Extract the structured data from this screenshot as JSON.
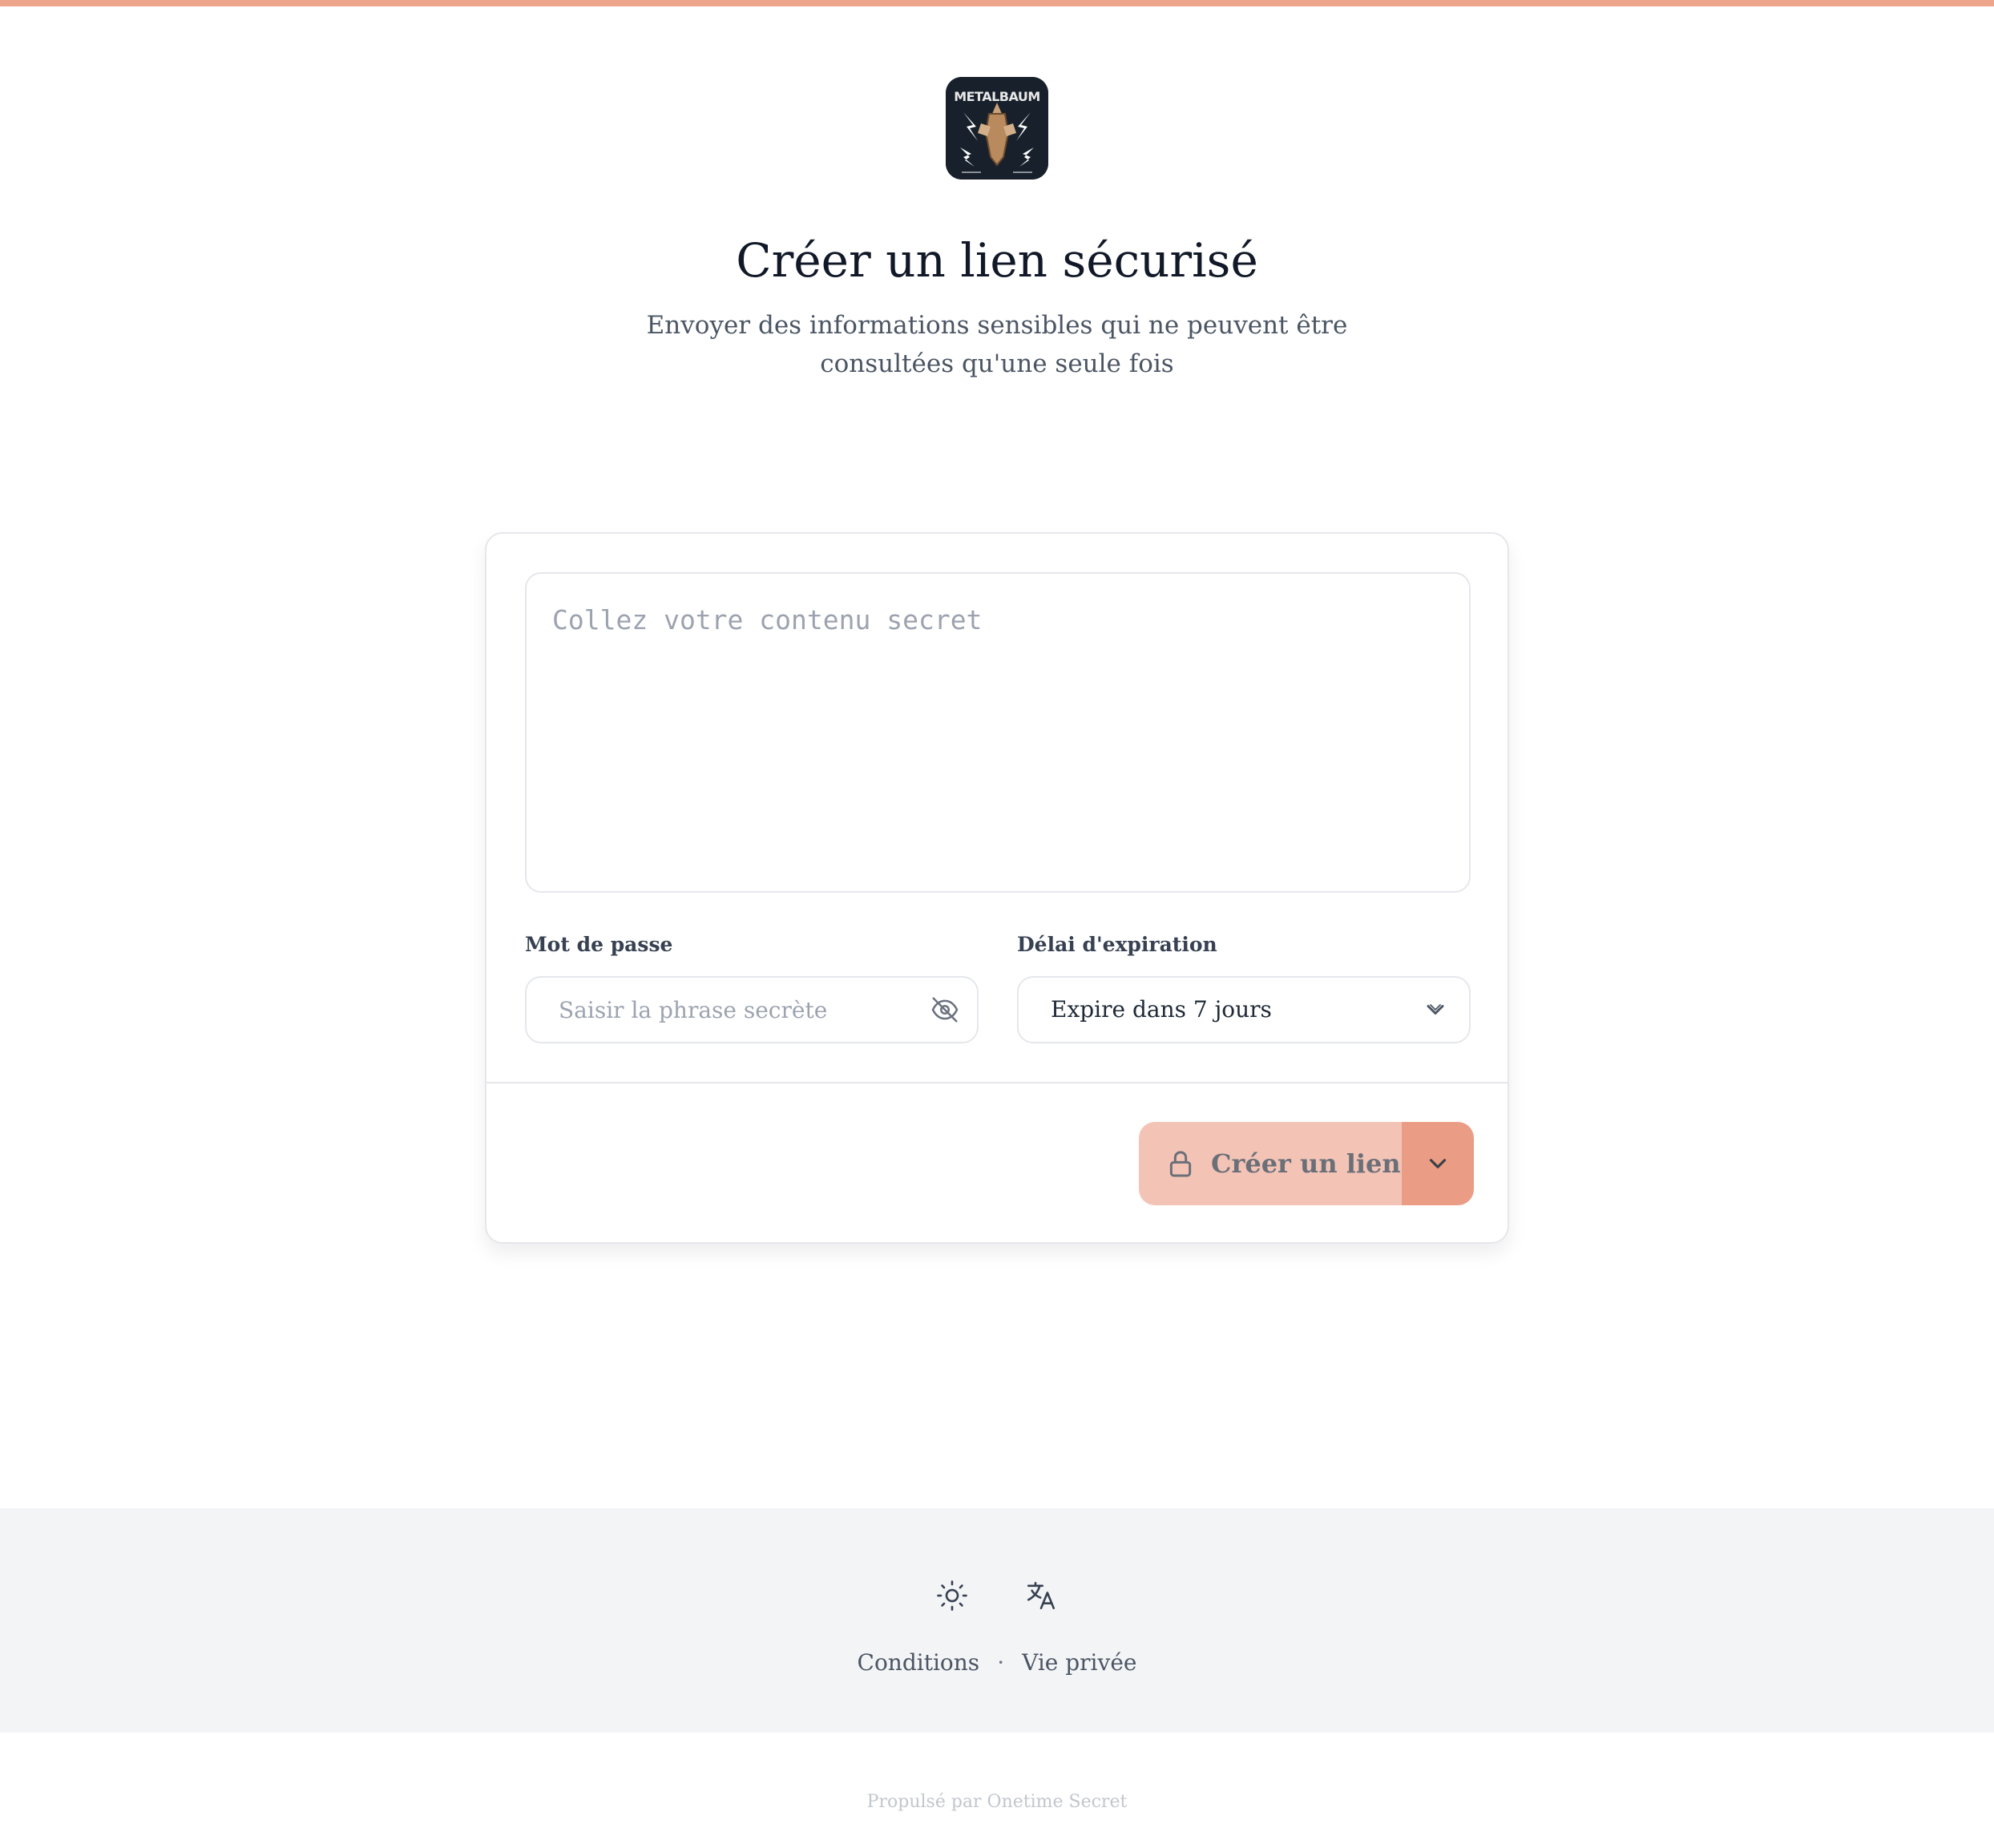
{
  "brand": {
    "logo_text": "METALBAUM",
    "accent_color": "#eca58b",
    "button_color": "#f3c4b6",
    "button_dark_color": "#ea9c84"
  },
  "header": {
    "title": "Créer un lien sécurisé",
    "subtitle": "Envoyer des informations sensibles qui ne peuvent être consultées qu'une seule fois"
  },
  "form": {
    "secret_placeholder": "Collez votre contenu secret",
    "secret_value": "",
    "password_label": "Mot de passe",
    "password_placeholder": "Saisir la phrase secrète",
    "password_value": "",
    "password_toggle_icon": "eye-off-icon",
    "expiration_label": "Délai d'expiration",
    "expiration_value": "Expire dans 7 jours",
    "expiration_icon": "chevron-down-icon",
    "submit_label": "Créer un lien",
    "submit_icon": "lock-icon",
    "options_icon": "chevron-down-icon"
  },
  "footer": {
    "theme_icon": "sun-icon",
    "language_icon": "translate-icon",
    "links": [
      "Conditions",
      "Vie privée"
    ],
    "separator": "·",
    "powered_by": "Propulsé par Onetime Secret"
  }
}
